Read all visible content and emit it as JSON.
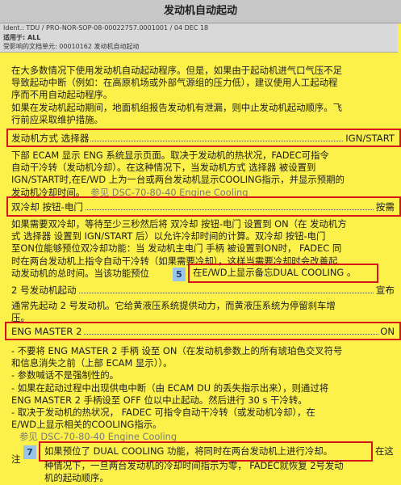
{
  "title": "发动机自动起动",
  "meta": {
    "ident": "Ident.: TDU / PRO-NOR-SOP-08-00022757.0001001 / 04 DEC 18",
    "applies": "适用于: ALL",
    "affected": "受影响的文档单元: 00010162 发动机自动起动"
  },
  "intro": {
    "lines": [
      "在大多数情况下使用发动机自动起动程序。但是，如果由于起动机进气口气压不足",
      "导致起动中断（例如：在高原机场或外部气源组的压力低），建议使用人工起动程",
      "序而不用自动起动程序。",
      "如果在发动机起动期间，地面机组报告发动机有泄漏，则中止发动机起动顺序。飞",
      "行前应采取维护措施。"
    ]
  },
  "ign_start": {
    "label": "发动机方式 选择器",
    "value": "IGN/START"
  },
  "ign_desc": {
    "lines": [
      "下部 ECAM 显示 ENG 系统显示页面。取决于发动机的热状况，FADEC可指令",
      "自动干冷转（发动机冷却）。在这种情况下，当发动机方式 选择器 被设置到",
      "IGN/START时,在E/WD 上为一台或两台发动机显示COOLING指示，并显示预期的",
      "发动机冷却时间。"
    ],
    "ref": "参见 DSC-70-80-40 Engine Cooling"
  },
  "dual_cooling": {
    "label": "双冷却 按钮-电门",
    "value": "按需"
  },
  "dual_desc": {
    "lines": [
      "如果需要双冷却，等待至少三秒然后将 双冷却 按钮-电门 设置到 ON（在 发动机方",
      "式 选择器 设置到 IGN/START 后）以允许冷却时间的计算。双冷却 按钮-电门 ",
      "至ON位能够预位双冷却功能：当 发动机主电门 手柄 被设置到ON时， FADEC 同",
      "时在两台发动机上指令自动干冷转（如果需要冷却），这样当需要冷却时会改善起",
      "动发动机的总时间。当该功能预位"
    ],
    "highlight": "在E/WD上显示备忘DUAL COOLING 。",
    "badge": "5"
  },
  "eng2_start": {
    "label": "2 号发动机起动",
    "value": "宣布",
    "desc": [
      "通常先起动 2 号发动机。它给黄液压系统提供动力，而黄液压系统为停留刹车增",
      "压。"
    ]
  },
  "eng_master": {
    "label": "ENG MASTER 2",
    "value": "ON"
  },
  "bullets": [
    "- 不要将 ENG MASTER 2 手柄 设至 ON（在发动机参数上的所有琥珀色交叉符号",
    "  和信息消失之前（上部 ECAM 显示））。",
    "- 参数喊话不是强制性的。",
    "- 如果在起动过程中出现供电中断（由 ECAM DU 的丢失指示出来），则通过将",
    "  ENG MASTER 2 手柄设至 OFF 位以中止起动。然后进行 30 s 干冷转。",
    "- 取决于发动机的热状况， FADEC 可指令自动干冷转（或发动机冷却），在",
    "  E/WD上显示相关的COOLING指示。"
  ],
  "bullets_ref": "参见 DSC-70-80-40 Engine Cooling",
  "note": {
    "label": "注",
    "badge": "7",
    "highlight": "如果预位了 DUAL COOLING 功能，将同时在两台发动机上进行冷却。",
    "tail": "在这",
    "lines": [
      "种情况下，一旦两台发动机的冷却时间指示为零， FADEC就恢复 2号发动",
      "机的起动顺序。"
    ]
  }
}
